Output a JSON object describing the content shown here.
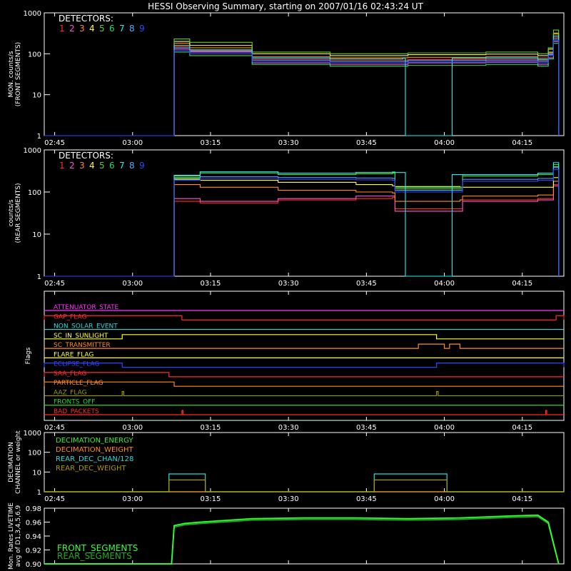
{
  "title": "HESSI Observing Summary, starting on 2007/01/16 02:43:24 UT",
  "time_axis": {
    "ticks": [
      "02:45",
      "03:00",
      "03:15",
      "03:30",
      "03:45",
      "04:00",
      "04:15"
    ],
    "tick_minutes": [
      2,
      17,
      32,
      47,
      62,
      77,
      92
    ]
  },
  "detector_colors": [
    "#ff2a2a",
    "#ff55cc",
    "#ff8c1a",
    "#ffff33",
    "#66cc22",
    "#22dd66",
    "#22eeee",
    "#55aaff",
    "#3344ff"
  ],
  "chart_data": [
    {
      "type": "line",
      "id": "front",
      "ylabel": "MON. counts/s\n(FRONT SEGMENTS)",
      "yscale": "log",
      "ylim": [
        1,
        1000
      ],
      "yticks": [
        "1",
        "10",
        "100",
        "1000"
      ],
      "legend_title": "DETECTORS:",
      "legend_items": [
        "1",
        "2",
        "3",
        "4",
        "5",
        "6",
        "7",
        "8",
        "9"
      ],
      "series": [
        {
          "x": [
            0,
            24.5,
            25,
            28,
            40,
            55,
            70,
            85,
            95,
            97,
            98,
            99
          ],
          "y": [
            1,
            1,
            150,
            120,
            75,
            70,
            72,
            75,
            70,
            100,
            250,
            1
          ]
        },
        {
          "x": [
            0,
            24.5,
            25,
            28,
            40,
            55,
            70,
            85,
            95,
            97,
            98,
            99
          ],
          "y": [
            1,
            1,
            130,
            110,
            60,
            55,
            60,
            62,
            55,
            80,
            200,
            1
          ]
        },
        {
          "x": [
            0,
            24.5,
            25,
            28,
            40,
            55,
            70,
            85,
            95,
            97,
            98,
            99
          ],
          "y": [
            1,
            1,
            180,
            140,
            85,
            80,
            82,
            85,
            78,
            110,
            300,
            1
          ]
        },
        {
          "x": [
            0,
            24.5,
            25,
            28,
            40,
            55,
            70,
            85,
            95,
            97,
            98,
            99
          ],
          "y": [
            1,
            1,
            200,
            160,
            100,
            90,
            95,
            98,
            90,
            130,
            320,
            1
          ]
        },
        {
          "x": [
            0,
            24.5,
            25,
            28,
            40,
            55,
            70,
            85,
            95,
            97,
            98,
            99
          ],
          "y": [
            1,
            1,
            230,
            190,
            110,
            100,
            105,
            110,
            100,
            140,
            380,
            1
          ]
        },
        {
          "x": [
            0,
            24.5,
            25,
            28,
            40,
            55,
            70,
            85,
            95,
            97,
            98,
            99
          ],
          "y": [
            1,
            1,
            110,
            90,
            55,
            50,
            52,
            55,
            50,
            75,
            180,
            1
          ]
        },
        {
          "x": [
            0,
            24.5,
            25,
            28,
            40,
            55,
            69,
            69.5,
            78,
            78.5,
            85,
            95,
            97,
            98,
            99
          ],
          "y": [
            1,
            1,
            160,
            125,
            80,
            75,
            78,
            1,
            1,
            78,
            80,
            72,
            105,
            270,
            1
          ]
        },
        {
          "x": [
            0,
            24.5,
            25,
            28,
            40,
            55,
            70,
            85,
            95,
            97,
            98,
            99
          ],
          "y": [
            1,
            1,
            140,
            115,
            70,
            65,
            68,
            70,
            65,
            95,
            230,
            1
          ]
        },
        {
          "x": [
            0,
            24.5,
            25,
            28,
            40,
            55,
            70,
            85,
            95,
            97,
            98,
            99
          ],
          "y": [
            1,
            1,
            120,
            100,
            65,
            60,
            62,
            65,
            60,
            90,
            210,
            1
          ]
        }
      ]
    },
    {
      "type": "line",
      "id": "rear",
      "ylabel": "counts/s\n(REAR SEGMENTS)",
      "yscale": "log",
      "ylim": [
        1,
        1000
      ],
      "yticks": [
        "1",
        "10",
        "100",
        "1000"
      ],
      "legend_title": "DETECTORS:",
      "legend_items": [
        "1",
        "2",
        "3",
        "4",
        "5",
        "6",
        "7",
        "8",
        "9"
      ],
      "series": [
        {
          "x": [
            0,
            24.5,
            25,
            30,
            45,
            60,
            67,
            67.5,
            80,
            80.5,
            95,
            98,
            99
          ],
          "y": [
            1,
            1,
            60,
            55,
            65,
            70,
            75,
            40,
            40,
            65,
            70,
            150,
            1
          ]
        },
        {
          "x": [
            0,
            24.5,
            25,
            30,
            45,
            60,
            67,
            67.5,
            80,
            80.5,
            95,
            98,
            99
          ],
          "y": [
            1,
            1,
            70,
            60,
            70,
            80,
            80,
            35,
            35,
            60,
            65,
            140,
            1
          ]
        },
        {
          "x": [
            0,
            24.5,
            25,
            30,
            45,
            60,
            67,
            67.5,
            80,
            80.5,
            95,
            98,
            99
          ],
          "y": [
            1,
            1,
            150,
            130,
            110,
            100,
            95,
            60,
            65,
            80,
            85,
            180,
            1
          ]
        },
        {
          "x": [
            0,
            24.5,
            25,
            30,
            45,
            60,
            67,
            67.5,
            80,
            80.5,
            95,
            98,
            99
          ],
          "y": [
            1,
            1,
            200,
            190,
            170,
            150,
            140,
            135,
            130,
            130,
            130,
            220,
            1
          ]
        },
        {
          "x": [
            0,
            24.5,
            25,
            30,
            45,
            60,
            67,
            67.5,
            80,
            80.5,
            95,
            98,
            99
          ],
          "y": [
            1,
            1,
            220,
            280,
            260,
            270,
            280,
            120,
            120,
            240,
            260,
            400,
            1
          ]
        },
        {
          "x": [
            0,
            24.5,
            25,
            30,
            45,
            60,
            67,
            67.5,
            80,
            80.5,
            95,
            98,
            99
          ],
          "y": [
            1,
            1,
            240,
            300,
            280,
            290,
            300,
            130,
            130,
            260,
            280,
            450,
            1
          ]
        },
        {
          "x": [
            0,
            24.5,
            25,
            30,
            45,
            60,
            69,
            69.5,
            78,
            78.5,
            95,
            98,
            99
          ],
          "y": [
            1,
            1,
            250,
            300,
            280,
            290,
            290,
            1,
            1,
            260,
            280,
            500,
            1
          ]
        },
        {
          "x": [
            0,
            24.5,
            25,
            30,
            45,
            60,
            67,
            67.5,
            80,
            80.5,
            95,
            98,
            99
          ],
          "y": [
            1,
            1,
            210,
            230,
            220,
            215,
            210,
            110,
            110,
            200,
            210,
            380,
            1
          ]
        },
        {
          "x": [
            0,
            24.5,
            25,
            30,
            45,
            60,
            67,
            67.5,
            80,
            80.5,
            95,
            98,
            99
          ],
          "y": [
            1,
            1,
            190,
            210,
            200,
            195,
            190,
            100,
            100,
            180,
            190,
            340,
            1
          ]
        }
      ]
    },
    {
      "type": "line",
      "id": "flags",
      "ylabel": "Flags",
      "flags": [
        {
          "name": "ATTENUATOR_STATE",
          "color": "#ff33ff",
          "highs": []
        },
        {
          "name": "GAP_FLAG",
          "color": "#ff2a2a",
          "highs": [
            [
              0,
              26.5
            ],
            [
              98.5,
              100
            ]
          ]
        },
        {
          "name": "NON_SOLAR_EVENT",
          "color": "#22dddd",
          "highs": []
        },
        {
          "name": "SC_IN_SUNLIGHT",
          "color": "#ffff33",
          "highs": [
            [
              15,
              75.5
            ]
          ]
        },
        {
          "name": "SC_TRANSMITTER",
          "color": "#ff8c1a",
          "highs": [
            [
              72,
              77
            ],
            [
              78,
              80
            ]
          ]
        },
        {
          "name": "FLARE_FLAG",
          "color": "#ffff33",
          "highs": []
        },
        {
          "name": "ECLIPSE_FLAG",
          "color": "#3344ff",
          "highs": [
            [
              0,
              15
            ],
            [
              75.5,
              100
            ]
          ]
        },
        {
          "name": "SAA_FLAG",
          "color": "#ff2a2a",
          "highs": [
            [
              0,
              24
            ]
          ]
        },
        {
          "name": "PARTICLE_FLAG",
          "color": "#ff8c1a",
          "highs": [
            [
              0,
              25
            ]
          ]
        },
        {
          "name": "AAZ_FLAG",
          "color": "#999900",
          "highs": [
            [
              15,
              15.3
            ],
            [
              75.5,
              75.8
            ]
          ]
        },
        {
          "name": "FRONTS_OFF",
          "color": "#22dd22",
          "highs": []
        },
        {
          "name": "BAD_PACKETS",
          "color": "#ff2a2a",
          "highs": [
            [
              26.5,
              26.7
            ],
            [
              96.5,
              96.7
            ]
          ]
        }
      ]
    },
    {
      "type": "line",
      "id": "decimation",
      "ylabel": "DECIMATION\nCHANNEL or weight",
      "yscale": "log",
      "ylim": [
        1,
        1000
      ],
      "yticks": [
        "1",
        "10",
        "100",
        "1000"
      ],
      "legend_items": [
        "DECIMATION_ENERGY",
        "DECIMATION_WEIGHT",
        "REAR_DEC_CHAN/128",
        "REAR_DEC_WEIGHT"
      ],
      "series": [
        {
          "color": "#33ee33",
          "x": [
            0,
            100
          ],
          "y": [
            1,
            1
          ]
        },
        {
          "color": "#ff8c1a",
          "x": [
            0,
            100
          ],
          "y": [
            1,
            1
          ]
        },
        {
          "color": "#22dddd",
          "x": [
            0,
            24,
            24,
            31,
            31,
            63.5,
            63.5,
            77.5,
            77.5,
            100
          ],
          "y": [
            1,
            1,
            8,
            8,
            1,
            1,
            8,
            8,
            1,
            1
          ]
        },
        {
          "color": "#aa9900",
          "x": [
            0,
            24,
            24,
            31,
            31,
            63.5,
            63.5,
            77.5,
            77.5,
            100
          ],
          "y": [
            1,
            1,
            4,
            4,
            1,
            1,
            4,
            4,
            1,
            1
          ]
        }
      ]
    },
    {
      "type": "line",
      "id": "livetime",
      "ylabel": "Mon. Rates LIVETIME\navg of D1,3,4,5,6,9",
      "ylim": [
        0.9,
        0.98
      ],
      "yticks": [
        "0.90",
        "0.92",
        "0.94",
        "0.96",
        "0.98"
      ],
      "legend_items": [
        "FRONT_SEGMENTS",
        "REAR_SEGMENTS"
      ],
      "series": [
        {
          "name": "FRONT_SEGMENTS",
          "color": "#33ff33",
          "x": [
            0,
            24.5,
            25,
            27,
            30,
            40,
            50,
            60,
            70,
            80,
            90,
            95,
            97,
            98,
            99
          ],
          "y": [
            0.9,
            0.9,
            0.955,
            0.958,
            0.96,
            0.965,
            0.966,
            0.966,
            0.965,
            0.966,
            0.969,
            0.97,
            0.96,
            0.93,
            0.9
          ]
        },
        {
          "name": "REAR_SEGMENTS",
          "color": "#22aa22",
          "x": [
            0,
            24.5,
            25,
            27,
            30,
            40,
            50,
            60,
            70,
            80,
            90,
            95,
            97,
            98,
            99
          ],
          "y": [
            0.9,
            0.9,
            0.953,
            0.956,
            0.958,
            0.963,
            0.964,
            0.964,
            0.963,
            0.964,
            0.967,
            0.968,
            0.958,
            0.928,
            0.9
          ]
        }
      ]
    }
  ]
}
